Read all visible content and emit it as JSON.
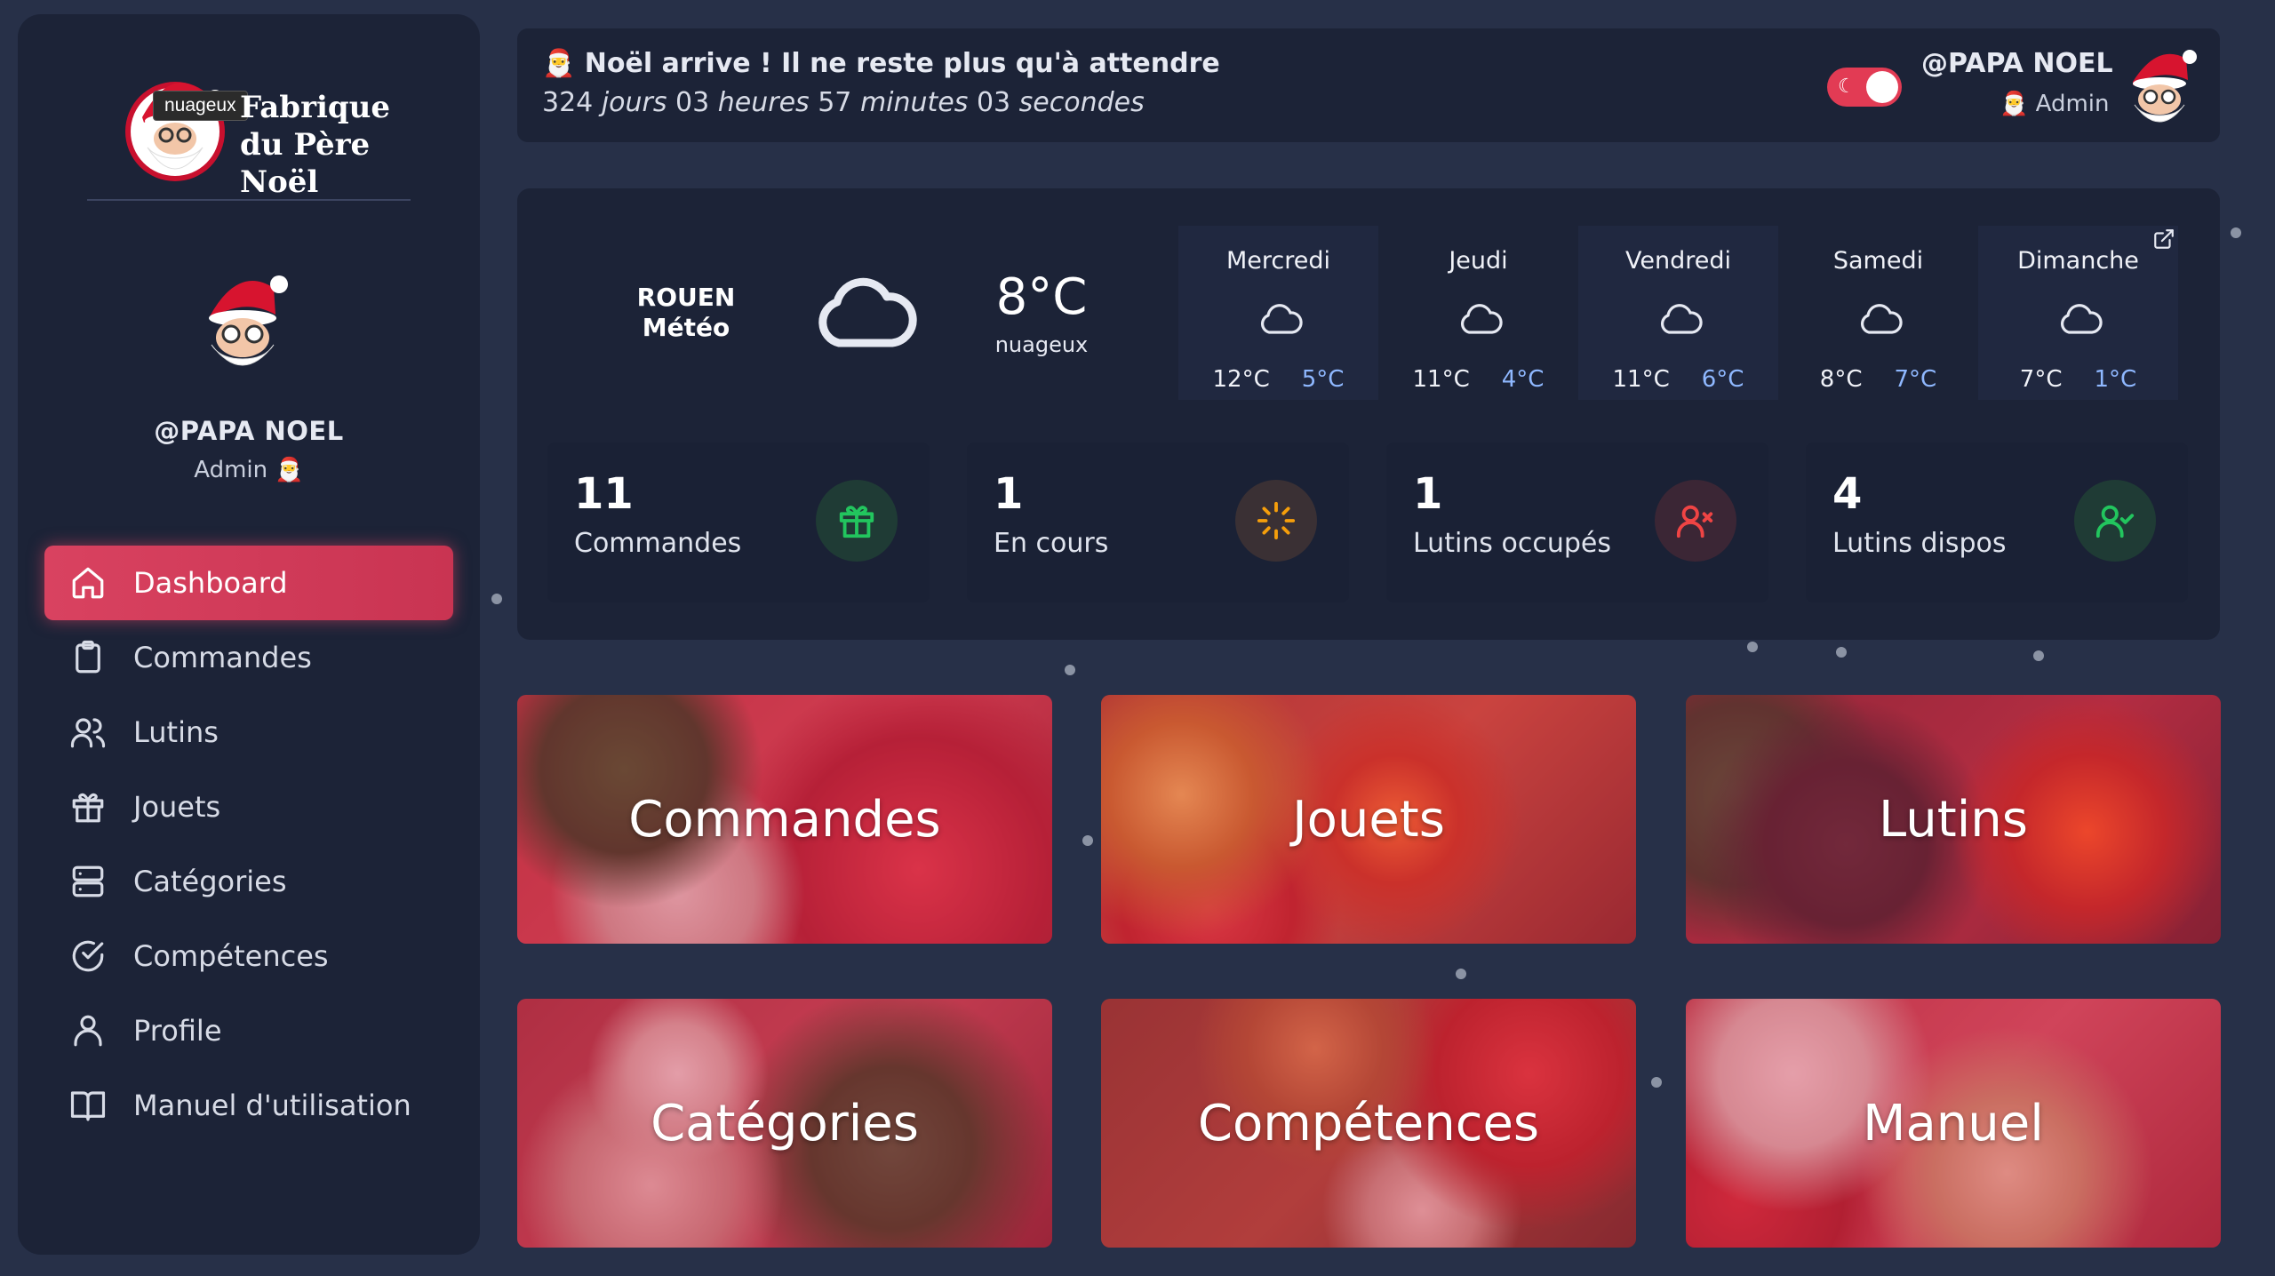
{
  "app": {
    "logo_tooltip": "nuageux",
    "logo_line1": "Fabrique",
    "logo_line2": "du Père Noël"
  },
  "sidebar": {
    "username": "@PAPA NOEL",
    "role": "Admin 🎅",
    "items": [
      {
        "label": "Dashboard",
        "icon": "home-icon",
        "active": true
      },
      {
        "label": "Commandes",
        "icon": "clipboard-icon"
      },
      {
        "label": "Lutins",
        "icon": "users-icon"
      },
      {
        "label": "Jouets",
        "icon": "gift-icon"
      },
      {
        "label": "Catégories",
        "icon": "server-icon"
      },
      {
        "label": "Compétences",
        "icon": "check-circle-icon"
      },
      {
        "label": "Profile",
        "icon": "user-icon"
      },
      {
        "label": "Manuel d'utilisation",
        "icon": "book-icon"
      }
    ]
  },
  "topbar": {
    "title": "🎅 Noël arrive ! Il ne reste plus qu'à attendre",
    "countdown": {
      "days": "324",
      "days_label": "jours",
      "hours": "03",
      "hours_label": "heures",
      "minutes": "57",
      "minutes_label": "minutes",
      "seconds": "03",
      "seconds_label": "secondes"
    },
    "theme_toggle_on": true,
    "username": "@PAPA NOEL",
    "role": "🎅 Admin"
  },
  "weather": {
    "city": "ROUEN",
    "label": "Météo",
    "temp": "8°C",
    "desc": "nuageux",
    "forecast": [
      {
        "day": "Mercredi",
        "hi": "12°C",
        "lo": "5°C"
      },
      {
        "day": "Jeudi",
        "hi": "11°C",
        "lo": "4°C"
      },
      {
        "day": "Vendredi",
        "hi": "11°C",
        "lo": "6°C"
      },
      {
        "day": "Samedi",
        "hi": "8°C",
        "lo": "7°C"
      },
      {
        "day": "Dimanche",
        "hi": "7°C",
        "lo": "1°C"
      }
    ]
  },
  "stats": [
    {
      "value": "11",
      "label": "Commandes",
      "icon": "gift-icon",
      "color": "#22c55e",
      "bg": "#1f3b35"
    },
    {
      "value": "1",
      "label": "En cours",
      "icon": "loader-icon",
      "color": "#f59e0b",
      "bg": "#3a3034"
    },
    {
      "value": "1",
      "label": "Lutins occupés",
      "icon": "user-x-icon",
      "color": "#ef4444",
      "bg": "#3b2635"
    },
    {
      "value": "4",
      "label": "Lutins dispos",
      "icon": "user-check-icon",
      "color": "#22c55e",
      "bg": "#1f3b35"
    }
  ],
  "tiles": [
    {
      "label": "Commandes"
    },
    {
      "label": "Jouets"
    },
    {
      "label": "Lutins"
    },
    {
      "label": "Catégories"
    },
    {
      "label": "Compétences"
    },
    {
      "label": "Manuel"
    }
  ],
  "colors": {
    "accent": "#d94260",
    "background": "#273048",
    "panel": "#1c2337",
    "temp_low": "#8fb8ff"
  }
}
